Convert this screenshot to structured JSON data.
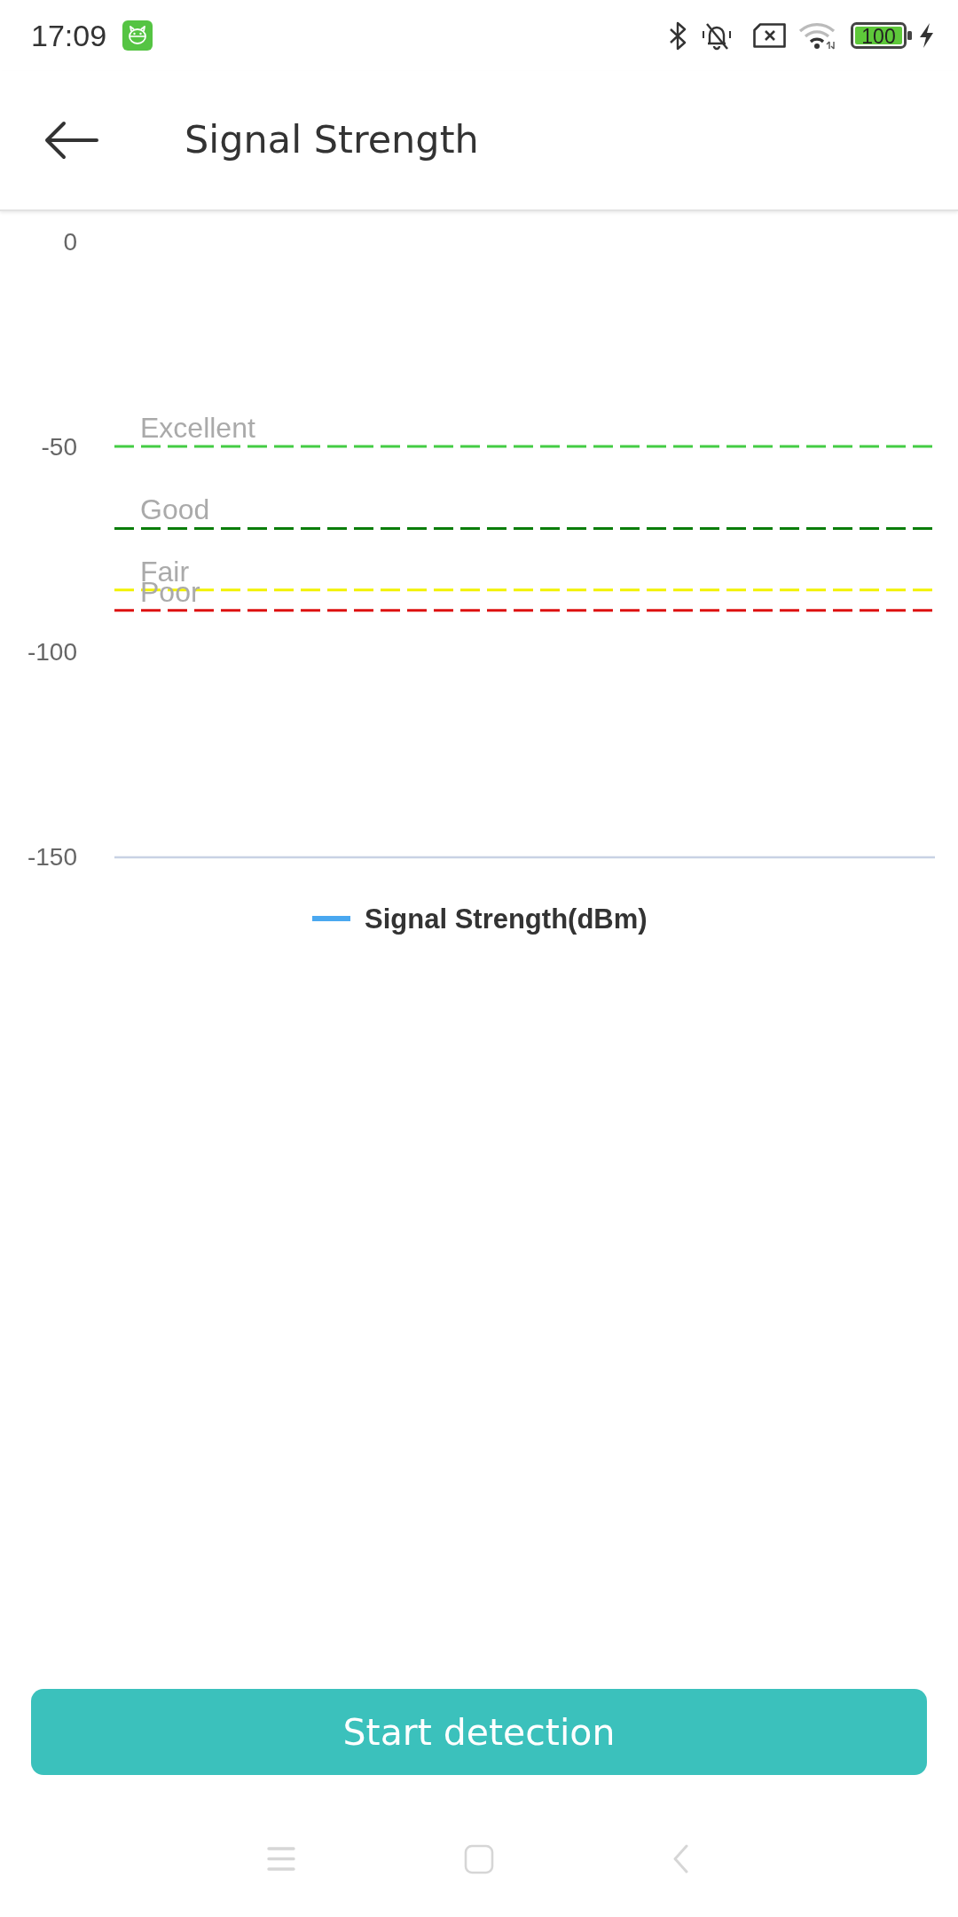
{
  "status_bar": {
    "time": "17:09",
    "battery": "100"
  },
  "header": {
    "title": "Signal Strength"
  },
  "chart": {
    "chart_data": {
      "type": "line",
      "ylim": [
        -150,
        0
      ],
      "yticks": [
        0,
        -50,
        -100,
        -150
      ],
      "series": [
        {
          "name": "Signal Strength(dBm)",
          "color": "#4aa8f0"
        }
      ],
      "ref_lines": [
        {
          "axis": "y",
          "value": -50,
          "label": "Excellent",
          "color": "#44cc44"
        },
        {
          "axis": "y",
          "value": -70,
          "label": "Good",
          "color": "#0a7d0a"
        },
        {
          "axis": "y",
          "value": -85,
          "label": "Fair",
          "color": "#f2f200"
        },
        {
          "axis": "y",
          "value": -90,
          "label": "Poor",
          "color": "#dd1111"
        }
      ]
    }
  },
  "button": {
    "label": "Start detection"
  }
}
